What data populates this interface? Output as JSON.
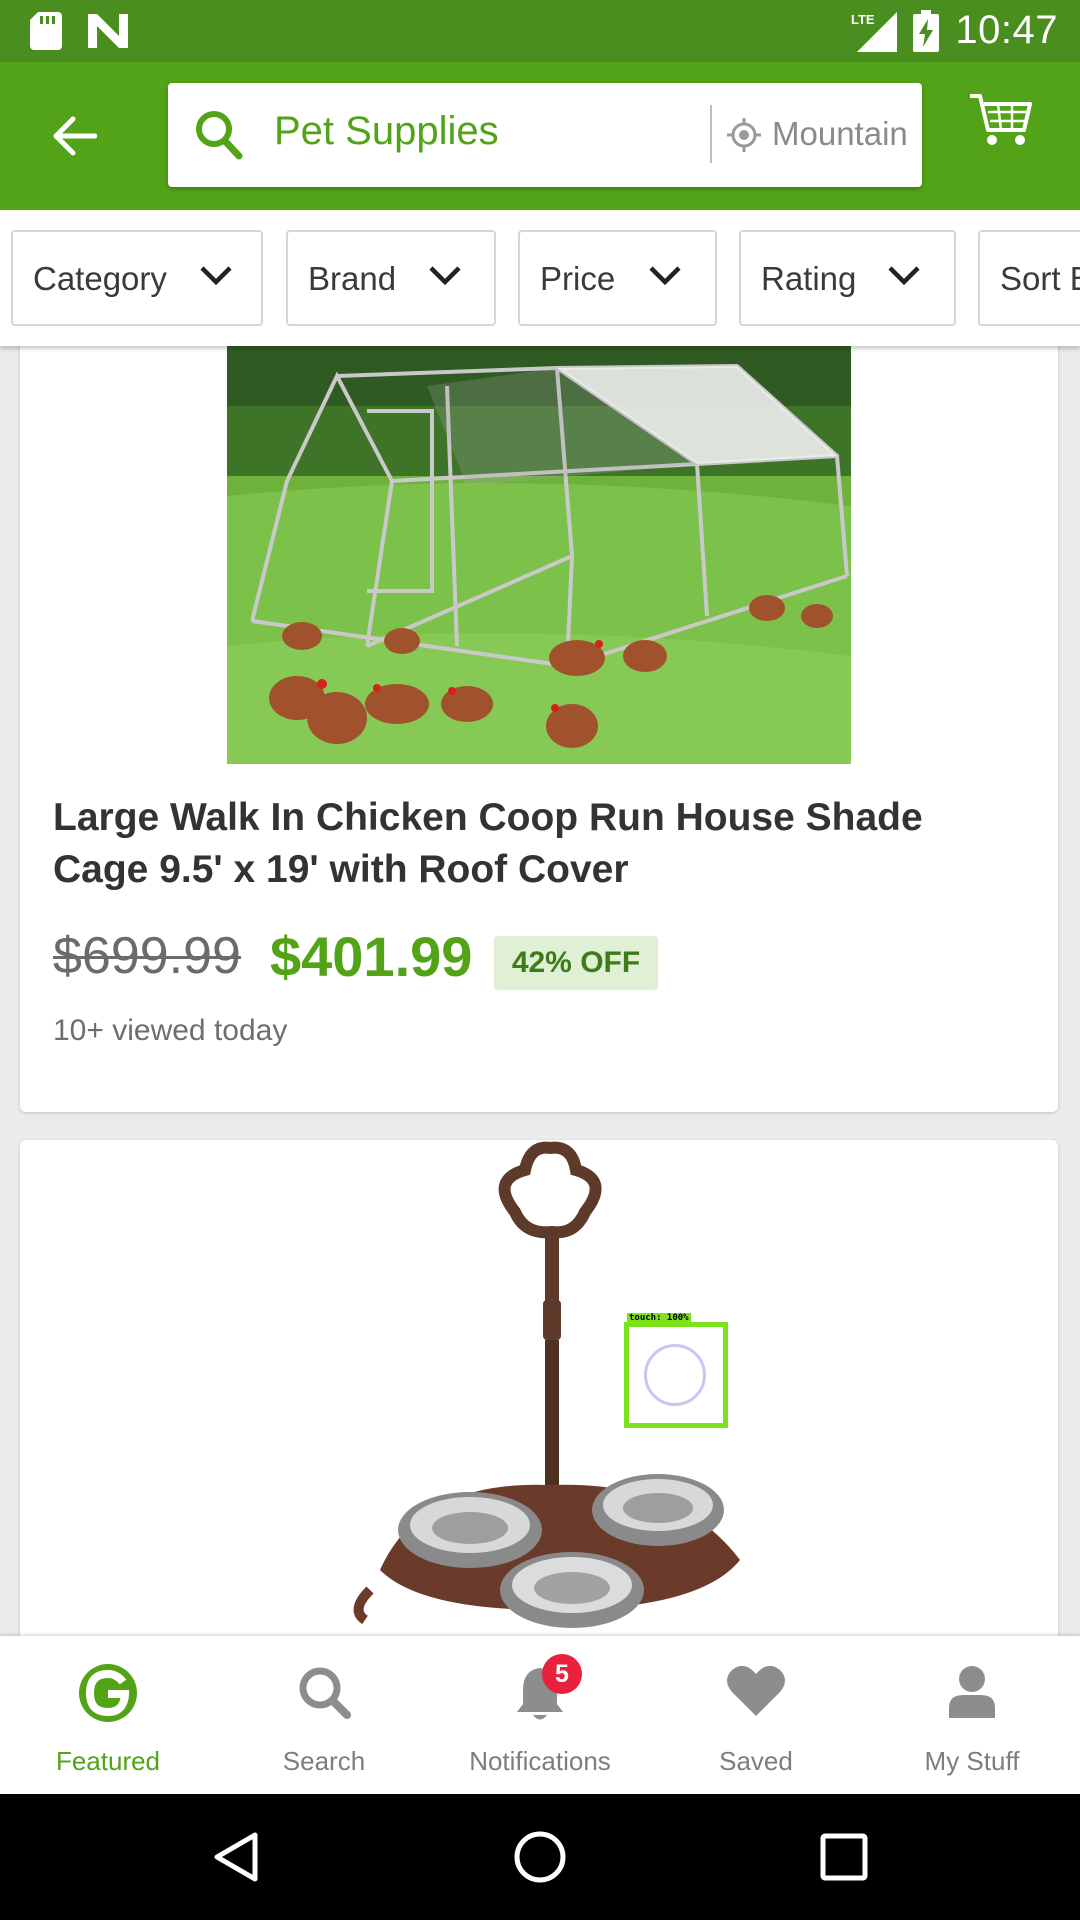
{
  "status_bar": {
    "time": "10:47",
    "network": "LTE"
  },
  "header": {
    "back_icon": "arrow-left-icon",
    "search_query": "Pet Supplies",
    "location": "Mountain View",
    "cart_icon": "cart-icon"
  },
  "filters": [
    {
      "label": "Category"
    },
    {
      "label": "Brand"
    },
    {
      "label": "Price"
    },
    {
      "label": "Rating"
    },
    {
      "label": "Sort By"
    }
  ],
  "products": [
    {
      "title": "Large Walk In Chicken Coop Run House Shade Cage 9.5' x 19' with Roof Cover",
      "original_price": "$699.99",
      "price": "$401.99",
      "discount": "42% OFF",
      "views": "10+ viewed today"
    },
    {
      "image": "cast-iron-pet-bowl-stand"
    }
  ],
  "overlay": {
    "touch_label": "touch: 100%"
  },
  "bottom_nav": {
    "items": [
      {
        "label": "Featured",
        "icon": "groupon-g-icon",
        "active": true
      },
      {
        "label": "Search",
        "icon": "search-icon"
      },
      {
        "label": "Notifications",
        "icon": "bell-icon",
        "badge": "5"
      },
      {
        "label": "Saved",
        "icon": "heart-icon"
      },
      {
        "label": "My Stuff",
        "icon": "person-icon"
      }
    ]
  },
  "colors": {
    "status_bar": "#4a8e1f",
    "brand_green": "#53a318",
    "badge_red": "#e8213f"
  }
}
